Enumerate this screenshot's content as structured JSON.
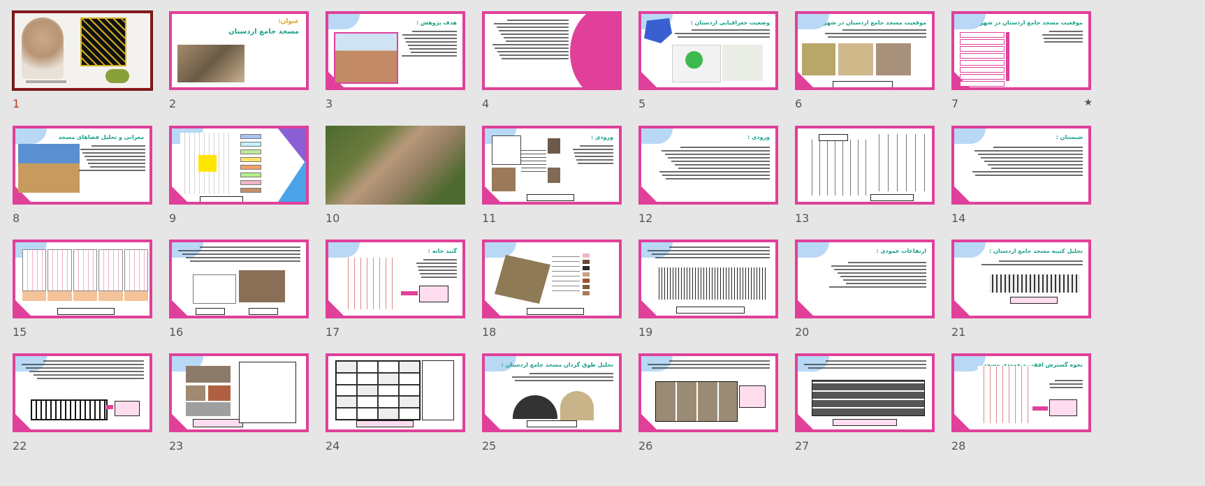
{
  "slides": [
    {
      "num": "1"
    },
    {
      "num": "2"
    },
    {
      "num": "3"
    },
    {
      "num": "4"
    },
    {
      "num": "5"
    },
    {
      "num": "6"
    },
    {
      "num": "7"
    },
    {
      "num": "8"
    },
    {
      "num": "9"
    },
    {
      "num": "10"
    },
    {
      "num": "11"
    },
    {
      "num": "12"
    },
    {
      "num": "13"
    },
    {
      "num": "14"
    },
    {
      "num": "15"
    },
    {
      "num": "16"
    },
    {
      "num": "17"
    },
    {
      "num": "18"
    },
    {
      "num": "19"
    },
    {
      "num": "20"
    },
    {
      "num": "21"
    },
    {
      "num": "22"
    },
    {
      "num": "23"
    },
    {
      "num": "24"
    },
    {
      "num": "25"
    },
    {
      "num": "26"
    },
    {
      "num": "27"
    },
    {
      "num": "28"
    }
  ],
  "titles": {
    "s2_label": "عنوان:",
    "s2_title": "مسجد جامع اردستان",
    "s3": "هدف پژوهش :",
    "s5": "وضعیت جغرافیایی اردستان :",
    "s6": "موقعیت مسجد جامع اردستان در شهر",
    "s7": "موقعیت مسجد جامع اردستان در شهر",
    "s8": "معرانی و تحلیل فضاهای مسجد",
    "s11": "ورودی :",
    "s12": "ورودی :",
    "s14": "شبستان :",
    "s17": "گنبد خانه :",
    "s20": "ارتفاعات عمودی :",
    "s21": "تحلیل کتیبه مسجد جامع اردستان :",
    "s25": "تحلیل طوق گردان مسجد جامع اردستان :",
    "s28": "نحوه گسترش افقی و عمودی مسجد"
  },
  "selected": "1",
  "star_marker": "★",
  "colors": {
    "accent": "#e0409a",
    "selected": "#8b1a1a",
    "green_title": "#16a085",
    "blue": "#4a6fd8",
    "purple": "#8a5fd6"
  }
}
